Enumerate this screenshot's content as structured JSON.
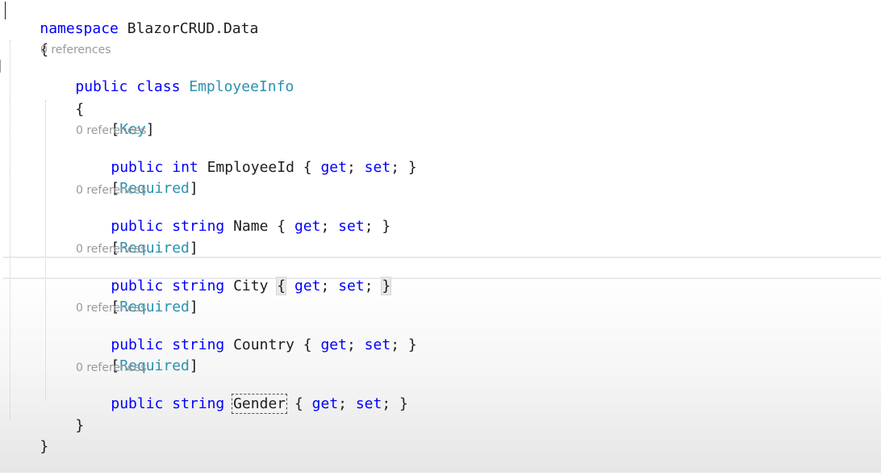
{
  "editor": {
    "namespace_line": {
      "keyword": "namespace",
      "name": " BlazorCRUD.Data"
    },
    "open_brace_outer": "{",
    "class_lens": "0 references",
    "class_line": {
      "kw1": "public",
      "kw2": " class ",
      "name": "EmployeeInfo"
    },
    "open_brace_inner": "{",
    "members": [
      {
        "attr_open": "[",
        "attr_name": "Key",
        "attr_close": "]",
        "lens": "0 references",
        "kw": "public",
        "type_kw": " int ",
        "name": "EmployeeId",
        "acc_open": " { ",
        "get": "get",
        "semi1": "; ",
        "set": "set",
        "acc_close": "; }"
      },
      {
        "attr_open": "[",
        "attr_name": "Required",
        "attr_close": "]",
        "lens": "0 references",
        "kw": "public",
        "type_kw": " string ",
        "name": "Name",
        "acc_open": " { ",
        "get": "get",
        "semi1": "; ",
        "set": "set",
        "acc_close": "; }"
      },
      {
        "attr_open": "[",
        "attr_name": "Required",
        "attr_close": "]",
        "lens": "0 references",
        "kw": "public",
        "type_kw": " string ",
        "name": "City",
        "acc_open": " { ",
        "get": "get",
        "semi1": "; ",
        "set": "set",
        "acc_close": "; ",
        "close_brace": "}"
      },
      {
        "attr_open": "[",
        "attr_name": "Required",
        "attr_close": "]",
        "lens": "0 references",
        "kw": "public",
        "type_kw": " string ",
        "name": "Country",
        "acc_open": " { ",
        "get": "get",
        "semi1": "; ",
        "set": "set",
        "acc_close": "; }"
      },
      {
        "attr_open": "[",
        "attr_name": "Required",
        "attr_close": "]",
        "lens": "0 references",
        "kw": "public",
        "type_kw": " string ",
        "name": "Gender",
        "acc_open": " { ",
        "get": "get",
        "semi1": "; ",
        "set": "set",
        "acc_close": "; }"
      }
    ],
    "close_brace_inner": "}",
    "close_brace_outer": "}"
  },
  "colors": {
    "keyword": "#0000ff",
    "type_name": "#2b91af",
    "identifier": "#1e1e1e",
    "codelens": "#9a9a9a"
  }
}
